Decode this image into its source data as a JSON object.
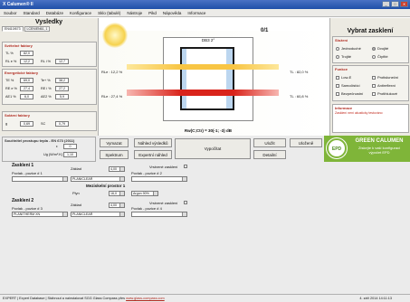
{
  "window": {
    "title": "X Calumen® II",
    "controls": [
      "_",
      "□",
      "✕"
    ]
  },
  "menu": [
    "Soubor",
    "Standard",
    "Databáze",
    "Konfigurace",
    "Sklo (tabulé)",
    "Nástroje",
    "Pikd",
    "Nápověda",
    "Informace"
  ],
  "left": {
    "title": "Vysledky",
    "tabs": [
      "EN410/673",
      "LCEN/EN61, 1"
    ],
    "spectral_title": "Světelné faktory",
    "spectral": [
      {
        "label": "TL %",
        "value": "82,0"
      },
      {
        "label": "RL e %",
        "value": "12,2",
        "label2": "RL i %",
        "value2": "12,7"
      }
    ],
    "energy_title": "Energetické faktory",
    "energy": [
      {
        "label": "TE %",
        "value": "69,0",
        "label2": "Te+ %",
        "value2": "38,2"
      },
      {
        "label": "RE e %",
        "value": "27,4",
        "label2": "RE i %",
        "value2": "27,2"
      },
      {
        "label": "AE1 %",
        "value": "6,0",
        "label2": "AE2 %",
        "value2": "5,9"
      }
    ],
    "solar_title": "Solární faktory",
    "solar": {
      "label": "g",
      "value": "0,69",
      "label2": "SC",
      "value2": "0,79"
    }
  },
  "diagram": {
    "page": "0/1",
    "glass_name": "DB3   2°",
    "left_labels": [
      "RLe : 12,2 %",
      "RLe : 27,4 %"
    ],
    "right_labels": [
      "TL : 82,0 %",
      "TL : 60,8 %"
    ],
    "formula": "Rw(C;Ctr) = 30(-1; -3) dB"
  },
  "right": {
    "title": "Vybrat zasklení",
    "glazing_title": "Složení",
    "glazing": [
      {
        "label": "Jednoduché",
        "on": false
      },
      {
        "label": "Dvojité",
        "on": true
      },
      {
        "label": "Trojité",
        "on": false
      },
      {
        "label": "Čtyřité",
        "on": false
      }
    ],
    "function_title": "Funkce",
    "functions": [
      "Low-E",
      "Protisluneční",
      "Samočistící",
      "Antireflexní",
      "Bezpečnostní",
      "Protihlukové"
    ],
    "info_title": "Informace",
    "info_text": "Zasklení není akusticky testováno"
  },
  "bottom": {
    "thermal_title": "Součinitel prostupu tepla - EN 673 (2011)",
    "u_label": "ε",
    "u_val": "0",
    "ug_label": "Ug (W/m².K)",
    "ug_val": "1,10",
    "buttons": [
      "Vymazat",
      "Náhled výsledků",
      "Vypočítat",
      "Uložit",
      "Otevřít",
      "Uloženě",
      "Spektrum",
      "Expertní náhled",
      "Detailní"
    ],
    "banner": {
      "title": "GREEN CALUMEN",
      "sub": "Získejte k vaší konfiguraci",
      "sub2": "výpočet EPD",
      "badge": "EPD"
    },
    "pane1": {
      "title": "Zasklení 1",
      "vrstvene": "Vrstvené zasklení",
      "povlak1_label": "Povlak - pozice # 1",
      "povlak1_val": "",
      "zaklad_label": "Základ",
      "zaklad_thick": "4,00",
      "zaklad_val": "PLANICLEAR",
      "povlak2_label": "Povlak - pozice # 2",
      "povlak2_val": ""
    },
    "gap": {
      "title": "Meziskelní prostor 1",
      "fill_label": "Plyn",
      "width": "16,0",
      "fill_val": "Argon 90%"
    },
    "pane2": {
      "title": "Zasklení 2",
      "vrstvene": "Vrstvené zasklení",
      "povlak3_label": "Povlak - pozice # 3",
      "povlak3_val": "PLANITHERM XN",
      "zaklad_label": "Základ",
      "zaklad_thick": "4,00",
      "zaklad_val": "PLANICLEAR",
      "povlak4_label": "Povlak - pozice # 4",
      "povlak4_val": ""
    }
  },
  "status": {
    "left": "EXPERT | Expert Database | Stáhnout a nainstalovat SGG Glass Compass přes",
    "link": "www.glass-compass.com",
    "right": "4. září 2014  14:11:13"
  },
  "colors": {
    "title": "#1f4fa8",
    "accent": "#b0291e",
    "green": "#7fb539"
  }
}
